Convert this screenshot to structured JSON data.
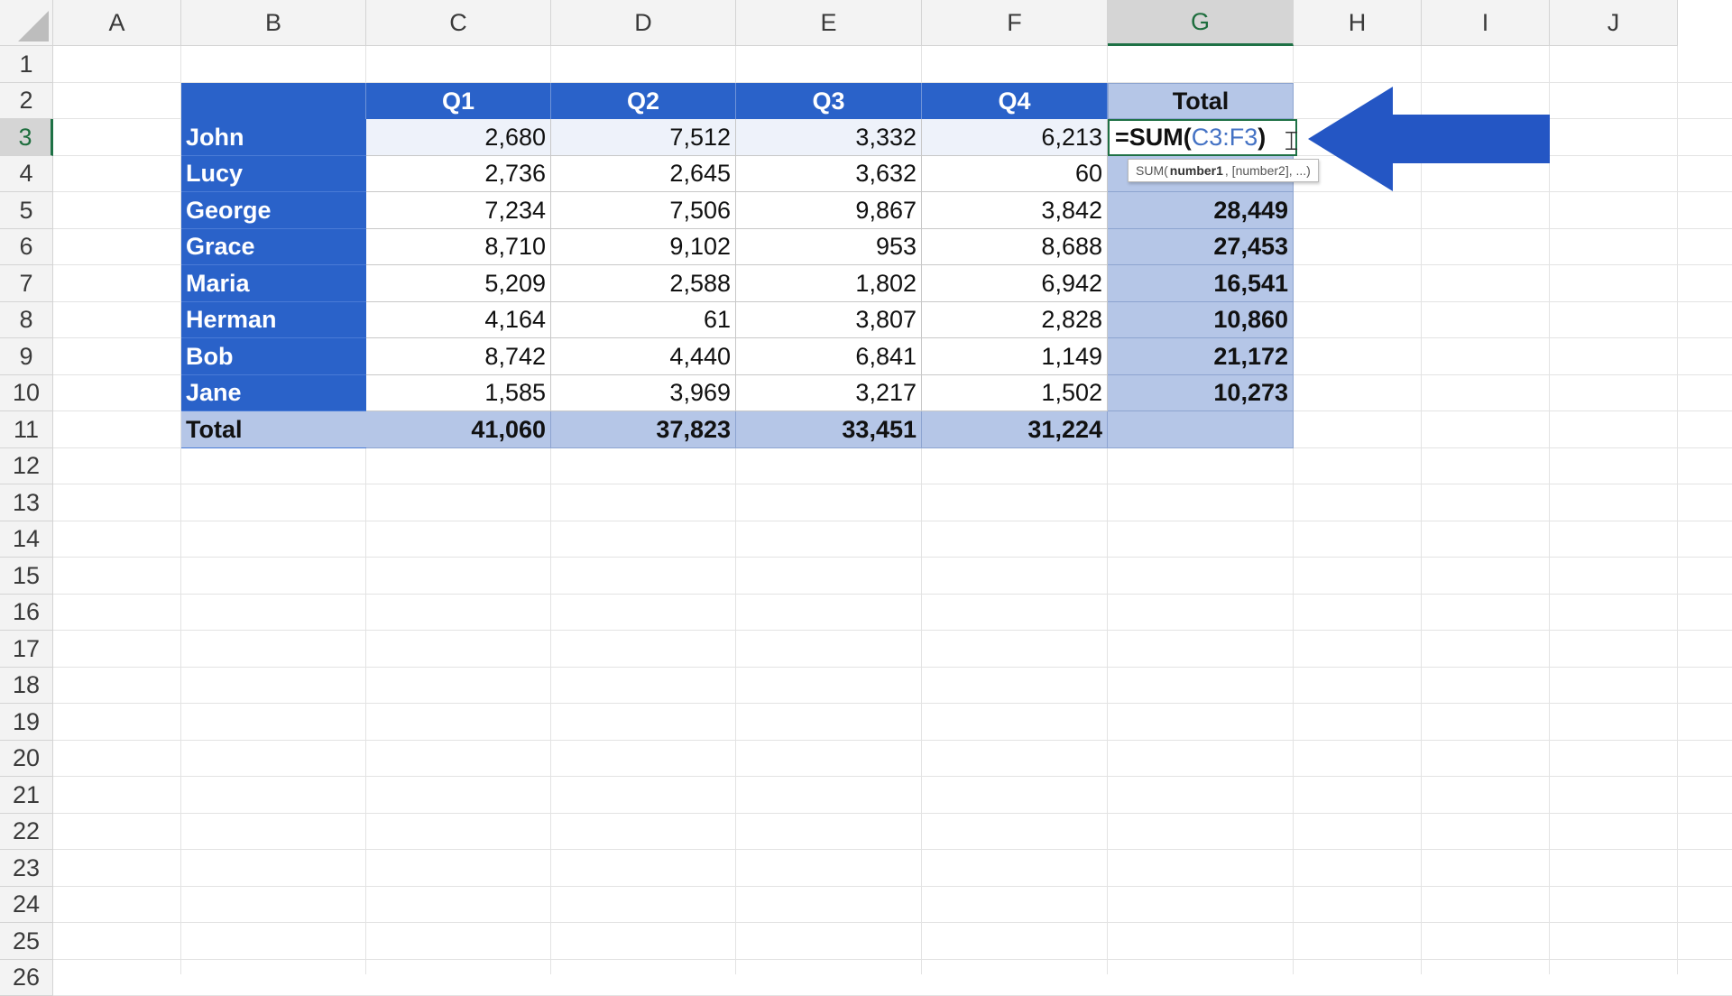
{
  "columns": [
    "A",
    "B",
    "C",
    "D",
    "E",
    "F",
    "G",
    "H",
    "I",
    "J"
  ],
  "rows": [
    "1",
    "2",
    "3",
    "4",
    "5",
    "6",
    "7",
    "8",
    "9",
    "10",
    "11",
    "12",
    "13",
    "14",
    "15",
    "16",
    "17",
    "18",
    "19",
    "20",
    "21",
    "22",
    "23",
    "24",
    "25",
    "26"
  ],
  "selected_column": "G",
  "selected_row": "3",
  "table": {
    "header": [
      "",
      "Q1",
      "Q2",
      "Q3",
      "Q4",
      "Total"
    ],
    "rows": [
      {
        "name": "John",
        "values": [
          "2,680",
          "7,512",
          "3,332",
          "6,213"
        ],
        "total": ""
      },
      {
        "name": "Lucy",
        "values": [
          "2,736",
          "2,645",
          "3,632",
          "60"
        ],
        "total": ""
      },
      {
        "name": "George",
        "values": [
          "7,234",
          "7,506",
          "9,867",
          "3,842"
        ],
        "total": "28,449"
      },
      {
        "name": "Grace",
        "values": [
          "8,710",
          "9,102",
          "953",
          "8,688"
        ],
        "total": "27,453"
      },
      {
        "name": "Maria",
        "values": [
          "5,209",
          "2,588",
          "1,802",
          "6,942"
        ],
        "total": "16,541"
      },
      {
        "name": "Herman",
        "values": [
          "4,164",
          "61",
          "3,807",
          "2,828"
        ],
        "total": "10,860"
      },
      {
        "name": "Bob",
        "values": [
          "8,742",
          "4,440",
          "6,841",
          "1,149"
        ],
        "total": "21,172"
      },
      {
        "name": "Jane",
        "values": [
          "1,585",
          "3,969",
          "3,217",
          "1,502"
        ],
        "total": "10,273"
      }
    ],
    "total_row": {
      "label": "Total",
      "values": [
        "41,060",
        "37,823",
        "33,451",
        "31,224"
      ],
      "total": ""
    }
  },
  "edit_cell": {
    "prefix": "=SUM(",
    "reference": "C3:F3",
    "suffix": ")"
  },
  "tooltip": {
    "func": "SUM(",
    "arg1": "number1",
    "rest": ", [number2], ...)"
  },
  "colors": {
    "header_blue": "#2a62c9",
    "light_blue": "#b5c6e7",
    "arrow_blue": "#2456c4",
    "reference_blue": "#4472c4",
    "selection_green": "#1e7145"
  }
}
